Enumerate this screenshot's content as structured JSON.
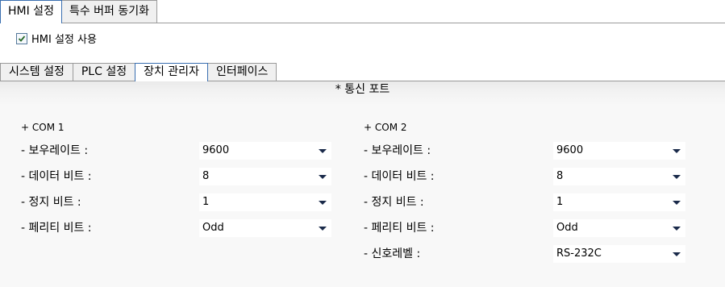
{
  "top_tabs": [
    {
      "label": "HMI 설정",
      "active": true
    },
    {
      "label": "특수 버퍼 동기화",
      "active": false
    }
  ],
  "checkbox": {
    "label": "HMI 설정 사용",
    "checked": true
  },
  "sub_tabs": [
    {
      "label": "시스템 설정",
      "active": false
    },
    {
      "label": "PLC 설정",
      "active": false
    },
    {
      "label": "장치 관리자",
      "active": true
    },
    {
      "label": "인터페이스",
      "active": false
    }
  ],
  "section_title": "* 통신 포트",
  "com1": {
    "header": "+ COM 1",
    "fields": [
      {
        "label": "- 보우레이트 :",
        "value": "9600"
      },
      {
        "label": "- 데이터 비트 :",
        "value": "8"
      },
      {
        "label": "- 정지 비트 :",
        "value": "1"
      },
      {
        "label": "- 페리티 비트 :",
        "value": "Odd"
      }
    ]
  },
  "com2": {
    "header": "+ COM 2",
    "fields": [
      {
        "label": "- 보우레이트 :",
        "value": "9600"
      },
      {
        "label": "- 데이터 비트 :",
        "value": "8"
      },
      {
        "label": "- 정지 비트 :",
        "value": "1"
      },
      {
        "label": "- 페리티 비트 :",
        "value": "Odd"
      },
      {
        "label": "- 신호레벨 :",
        "value": "RS-232C"
      }
    ]
  },
  "colors": {
    "active_tab_border": "#3a6fb0",
    "checkmark": "#2a6a2a"
  }
}
